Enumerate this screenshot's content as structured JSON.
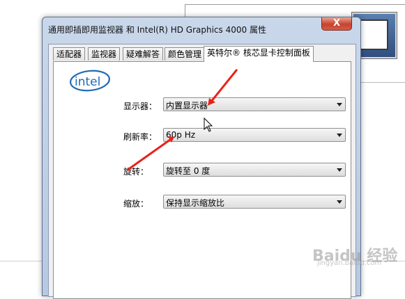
{
  "dialog": {
    "title": "通用即插即用监视器 和 Intel(R) HD Graphics 4000 属性",
    "close_label": "X",
    "tabs": [
      {
        "label": "适配器"
      },
      {
        "label": "监视器"
      },
      {
        "label": "疑难解答"
      },
      {
        "label": "颜色管理"
      },
      {
        "label": "英特尔® 核芯显卡控制面板"
      }
    ],
    "active_tab": "英特尔® 核芯显卡控制面板"
  },
  "logo": {
    "text": "intel"
  },
  "settings": {
    "display": {
      "label": "显示器：",
      "value": "内置显示器"
    },
    "refresh": {
      "label": "刷新率：",
      "value": "60p Hz"
    },
    "rotation": {
      "label": "旋转：",
      "value": "旋转至 0 度"
    },
    "scaling": {
      "label": "缩放：",
      "value": "保持显示缩放比"
    }
  },
  "watermark": {
    "text": "Baidu 经验",
    "sub": "jingyan.baidu.com"
  },
  "colors": {
    "annotation_arrow": "#e8231a",
    "intel_blue": "#1f6bb5"
  },
  "icons": [
    "intel-logo",
    "chevron-down-icon",
    "mouse-cursor-icon",
    "monitor-icon"
  ]
}
